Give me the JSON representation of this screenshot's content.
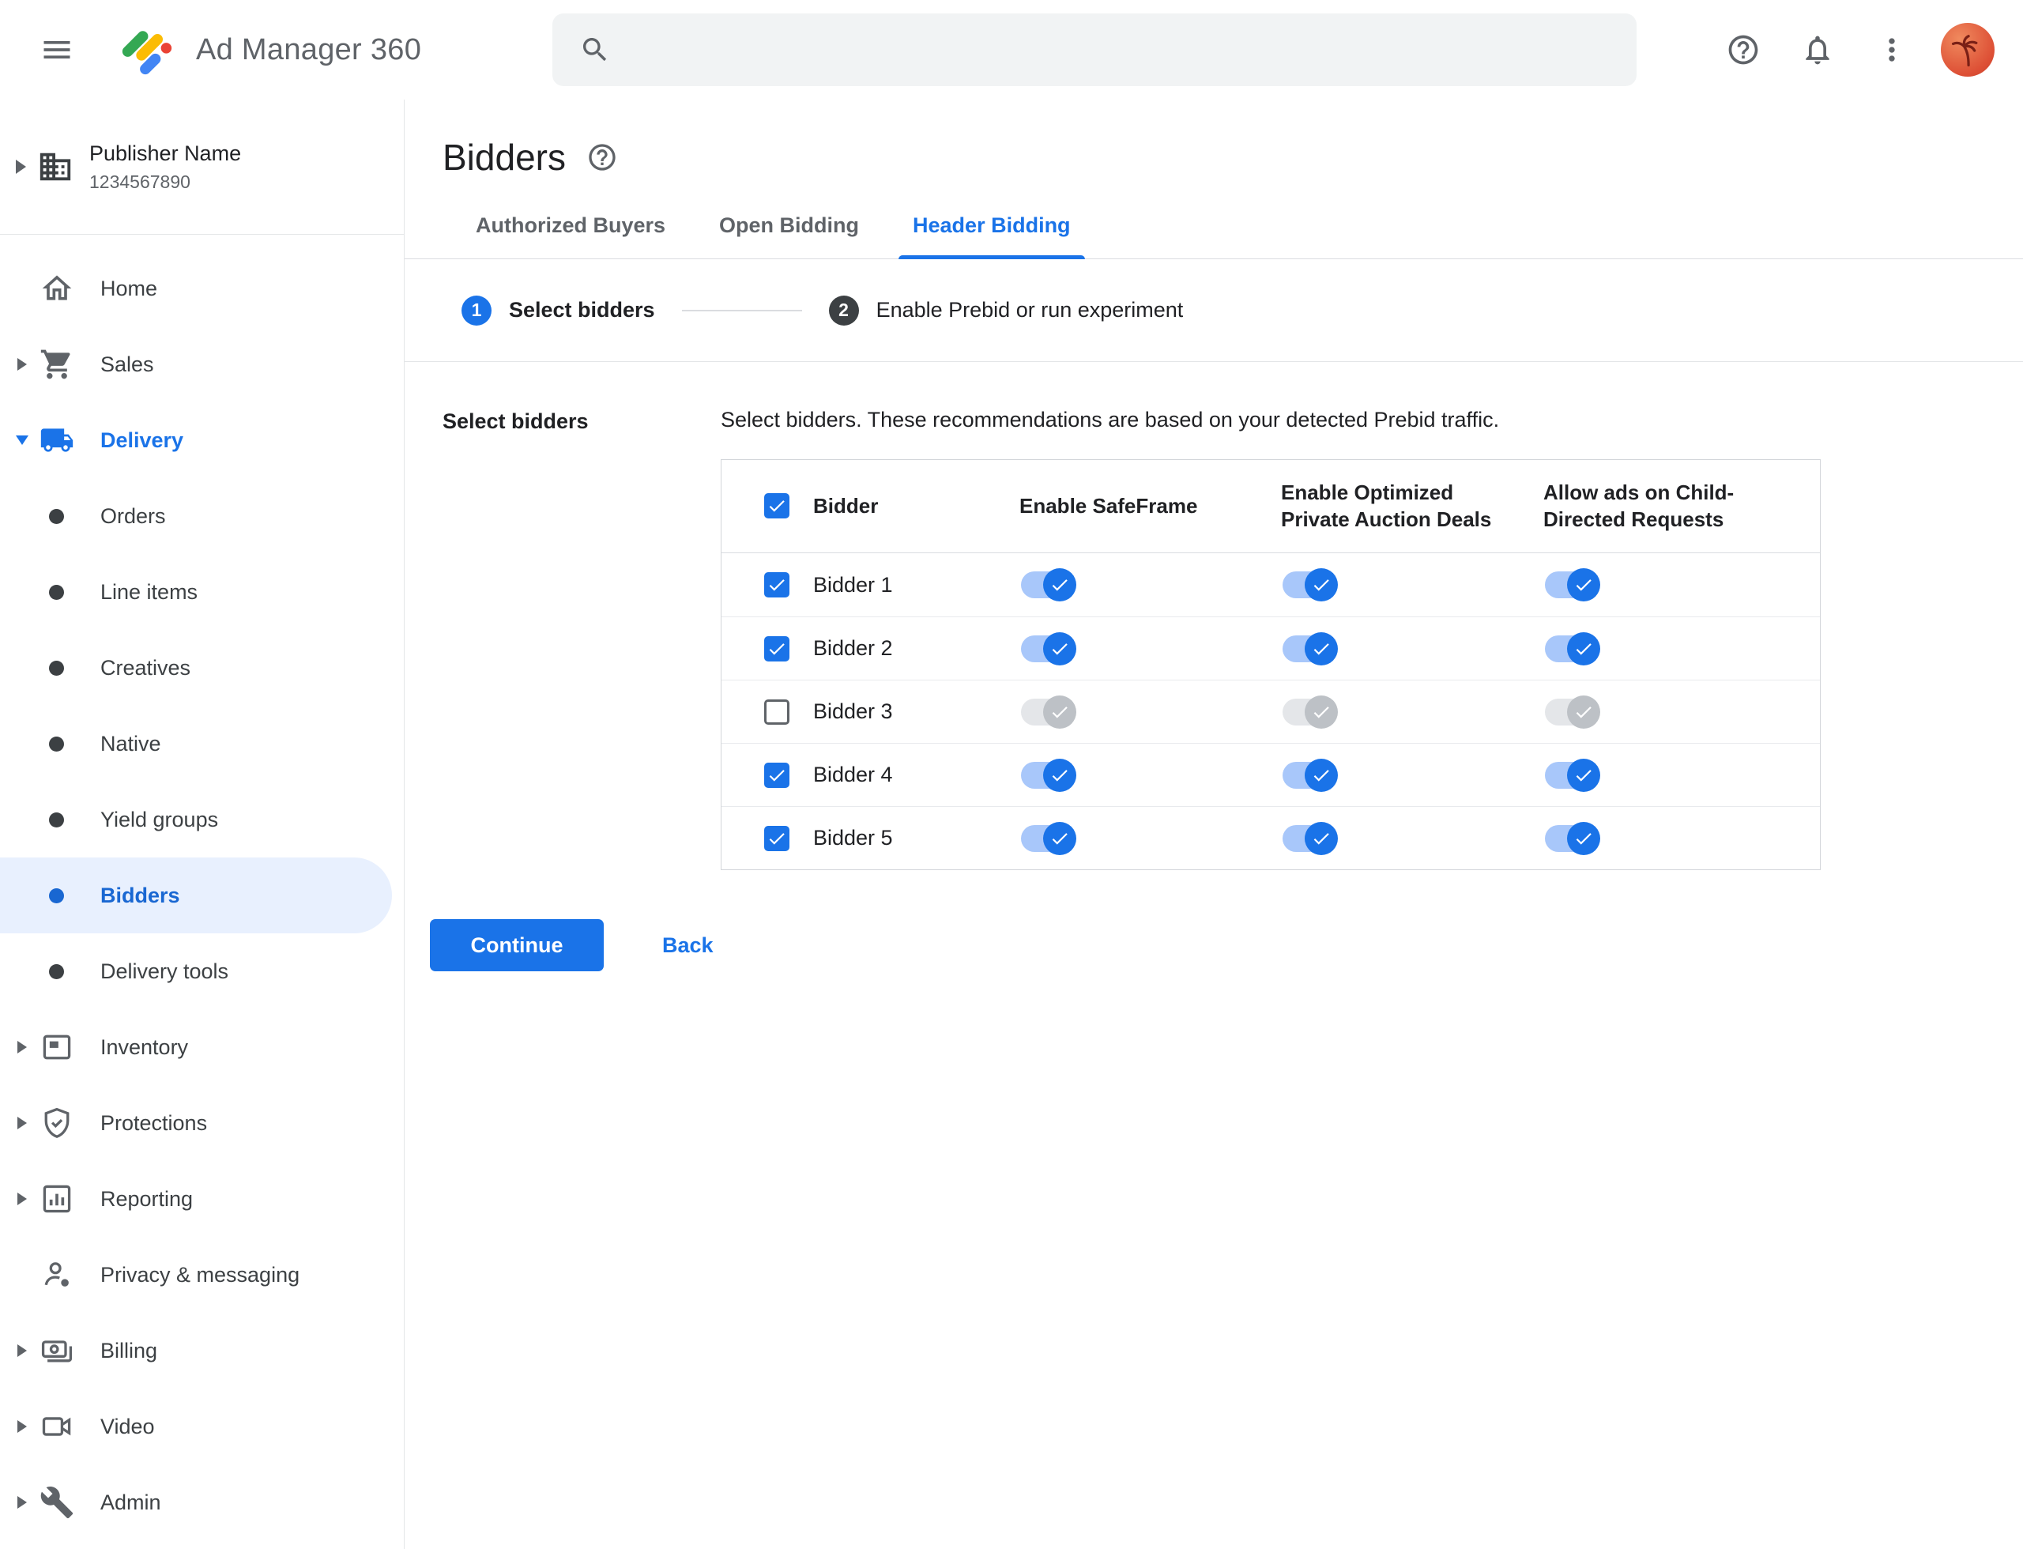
{
  "topbar": {
    "app_title": "Ad Manager 360",
    "search": {
      "value": "",
      "placeholder": ""
    }
  },
  "publisher": {
    "name": "Publisher Name",
    "id": "1234567890"
  },
  "sidebar": {
    "selected": "Bidders",
    "items": [
      {
        "label": "Home"
      },
      {
        "label": "Sales",
        "expandable": true
      },
      {
        "label": "Delivery",
        "expandable": true,
        "expanded": true
      },
      {
        "label": "Orders",
        "parent": "Delivery"
      },
      {
        "label": "Line items",
        "parent": "Delivery"
      },
      {
        "label": "Creatives",
        "parent": "Delivery"
      },
      {
        "label": "Native",
        "parent": "Delivery"
      },
      {
        "label": "Yield groups",
        "parent": "Delivery"
      },
      {
        "label": "Bidders",
        "parent": "Delivery",
        "selected": true
      },
      {
        "label": "Delivery tools",
        "parent": "Delivery"
      },
      {
        "label": "Inventory",
        "expandable": true
      },
      {
        "label": "Protections",
        "expandable": true
      },
      {
        "label": "Reporting",
        "expandable": true
      },
      {
        "label": "Privacy & messaging"
      },
      {
        "label": "Billing",
        "expandable": true
      },
      {
        "label": "Video",
        "expandable": true
      },
      {
        "label": "Admin",
        "expandable": true
      }
    ]
  },
  "page": {
    "title": "Bidders",
    "tabs": [
      {
        "label": "Authorized Buyers",
        "active": false
      },
      {
        "label": "Open Bidding",
        "active": false
      },
      {
        "label": "Header Bidding",
        "active": true
      }
    ],
    "stepper": [
      {
        "number": "1",
        "label": "Select bidders"
      },
      {
        "number": "2",
        "label": "Enable Prebid or run experiment"
      }
    ],
    "section_label": "Select bidders",
    "description": "Select bidders. These recommendations are based on your detected Prebid traffic.",
    "table": {
      "header_checked": true,
      "header": {
        "bidder": "Bidder",
        "safeframe": "Enable SafeFrame",
        "optimized": "Enable Optimized Private Auction Deals",
        "child_directed": "Allow ads on Child-Directed Requests"
      },
      "rows": [
        {
          "name": "Bidder 1",
          "checked": true,
          "safeframe": true,
          "optimized": true,
          "child_directed": true
        },
        {
          "name": "Bidder 2",
          "checked": true,
          "safeframe": true,
          "optimized": true,
          "child_directed": true
        },
        {
          "name": "Bidder 3",
          "checked": false,
          "safeframe": false,
          "optimized": false,
          "child_directed": false
        },
        {
          "name": "Bidder 4",
          "checked": true,
          "safeframe": true,
          "optimized": true,
          "child_directed": true
        },
        {
          "name": "Bidder 5",
          "checked": true,
          "safeframe": true,
          "optimized": true,
          "child_directed": true
        }
      ]
    },
    "actions": {
      "continue": "Continue",
      "back": "Back"
    }
  },
  "colors": {
    "accent": "#1a73e8",
    "selected_nav_bg": "#e8f0fe",
    "selected_nav_text": "#1967d2",
    "toggle_on_track": "#a8c7fa",
    "toggle_off_track": "#e4e6e9",
    "toggle_off_thumb": "#bdc1c6",
    "step2_circle": "#3c4043",
    "border": "#dadce0",
    "text_primary": "#202124",
    "text_secondary": "#5f6368"
  }
}
